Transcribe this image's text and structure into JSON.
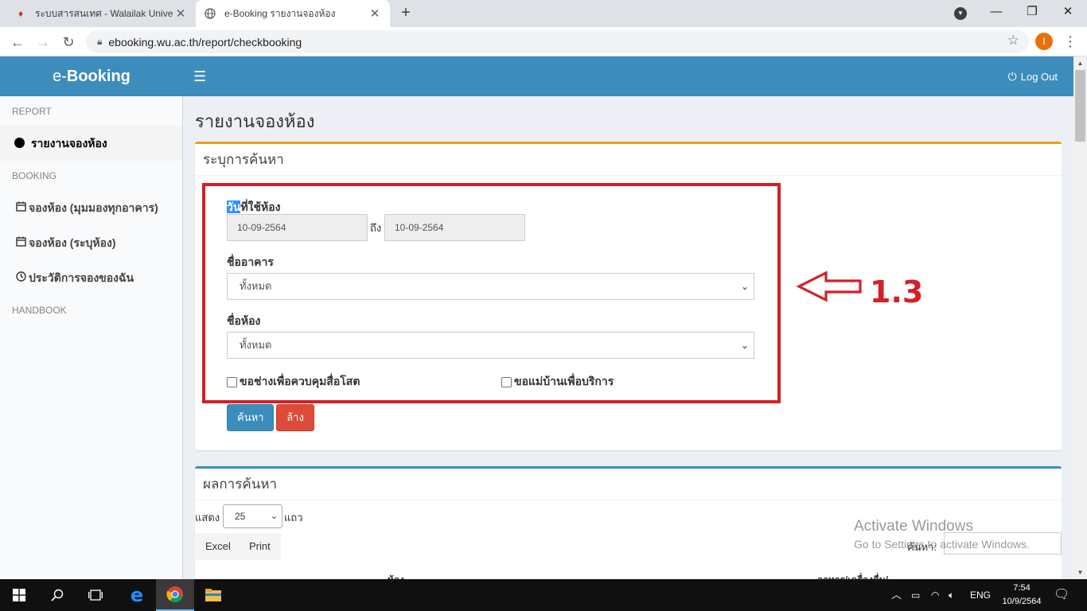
{
  "browser": {
    "tabs": [
      {
        "title": "ระบบสารสนเทศ - Walailak Universit",
        "active": false,
        "favicon": "university-seal-icon"
      },
      {
        "title": "e-Booking รายงานจองห้อง",
        "active": true,
        "favicon": "globe-icon"
      }
    ],
    "url": "ebooking.wu.ac.th/report/checkbooking",
    "profile_initial": "I"
  },
  "header": {
    "brand_prefix": "e-",
    "brand_name": "Booking",
    "logout_label": "Log Out",
    "color": "#3c8dbc"
  },
  "sidebar": {
    "sections": [
      {
        "heading": "REPORT",
        "items": [
          {
            "label": "รายงานจองห้อง",
            "icon": "circle-dot-icon",
            "active": true
          }
        ]
      },
      {
        "heading": "BOOKING",
        "items": [
          {
            "label": "จองห้อง (มุมมองทุกอาคาร)",
            "icon": "calendar-icon"
          },
          {
            "label": "จองห้อง (ระบุห้อง)",
            "icon": "calendar-icon"
          },
          {
            "label": "ประวัติการจองของฉัน",
            "icon": "clock-icon"
          }
        ]
      },
      {
        "heading": "HANDBOOK",
        "items": []
      }
    ]
  },
  "page": {
    "title": "รายงานจองห้อง",
    "search_box": {
      "title": "ระบุการค้นหา",
      "date_label_highlight": "วัน",
      "date_label_rest": "ที่ใช้ห้อง",
      "date_from": "10-09-2564",
      "to_label": "ถึง",
      "date_to": "10-09-2564",
      "building_label": "ชื่ออาคาร",
      "building_value": "ทั้งหมด",
      "room_label": "ชื่อห้อง",
      "room_value": "ทั้งหมด",
      "checkbox_technician": "ขอช่างเพื่อควบคุมสื่อโสต",
      "checkbox_housekeeper": "ขอแม่บ้านเพื่อบริการ",
      "search_button": "ค้นหา",
      "clear_button": "ล้าง"
    },
    "results_box": {
      "title": "ผลการค้นหา",
      "show_label": "แสดง",
      "page_length": "25",
      "rows_label": "แถว",
      "excel_button": "Excel",
      "print_button": "Print",
      "search_label": "ค้นหา:",
      "columns": [
        "ห้อง",
        "อาหาร/เครื่องดื่ม/"
      ]
    }
  },
  "annotation": {
    "label": "1.3",
    "color": "#d42026"
  },
  "watermark": {
    "line1": "Activate Windows",
    "line2": "Go to Settings to activate Windows."
  },
  "taskbar": {
    "language": "ENG",
    "time": "7:54",
    "date": "10/9/2564"
  }
}
